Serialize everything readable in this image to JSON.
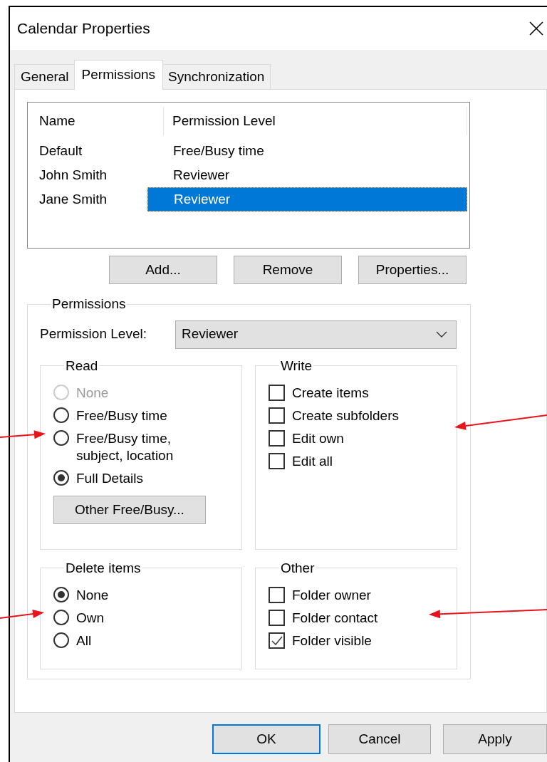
{
  "window": {
    "title": "Calendar Properties"
  },
  "tabs": [
    {
      "label": "General",
      "selected": false
    },
    {
      "label": "Permissions",
      "selected": true
    },
    {
      "label": "Synchronization",
      "selected": false
    }
  ],
  "permissions_list": {
    "columns": [
      "Name",
      "Permission Level"
    ],
    "rows": [
      {
        "name": "Default",
        "permission_level": "Free/Busy time",
        "selected": false
      },
      {
        "name": "John Smith",
        "permission_level": "Reviewer",
        "selected": false
      },
      {
        "name": "Jane Smith",
        "permission_level": "Reviewer",
        "selected": true
      }
    ]
  },
  "list_buttons": [
    {
      "label": "Add..."
    },
    {
      "label": "Remove"
    },
    {
      "label": "Properties..."
    }
  ],
  "permissions": {
    "title": "Permissions",
    "level_label": "Permission Level:",
    "level_value": "Reviewer",
    "groups": [
      {
        "title": "Read",
        "kind": "radio",
        "annotated": true,
        "items": [
          {
            "label": "None",
            "checked": false,
            "disabled": true
          },
          {
            "label": "Free/Busy time",
            "checked": false,
            "disabled": false
          },
          {
            "label": "Free/Busy time, subject, location",
            "checked": false,
            "disabled": false
          },
          {
            "label": "Full Details",
            "checked": true,
            "disabled": false
          }
        ],
        "button": {
          "label": "Other Free/Busy..."
        }
      },
      {
        "title": "Write",
        "kind": "checkbox",
        "annotated": true,
        "items": [
          {
            "label": "Create items",
            "checked": false
          },
          {
            "label": "Create subfolders",
            "checked": false
          },
          {
            "label": "Edit own",
            "checked": false
          },
          {
            "label": "Edit all",
            "checked": false
          }
        ]
      },
      {
        "title": "Delete items",
        "kind": "radio",
        "annotated": true,
        "items": [
          {
            "label": "None",
            "checked": true,
            "disabled": false
          },
          {
            "label": "Own",
            "checked": false,
            "disabled": false
          },
          {
            "label": "All",
            "checked": false,
            "disabled": false
          }
        ]
      },
      {
        "title": "Other",
        "kind": "checkbox",
        "annotated": true,
        "items": [
          {
            "label": "Folder owner",
            "checked": false
          },
          {
            "label": "Folder contact",
            "checked": false
          },
          {
            "label": "Folder visible",
            "checked": true
          }
        ]
      }
    ]
  },
  "footer_buttons": [
    {
      "label": "OK",
      "default": true
    },
    {
      "label": "Cancel",
      "default": false
    },
    {
      "label": "Apply",
      "default": false
    }
  ]
}
